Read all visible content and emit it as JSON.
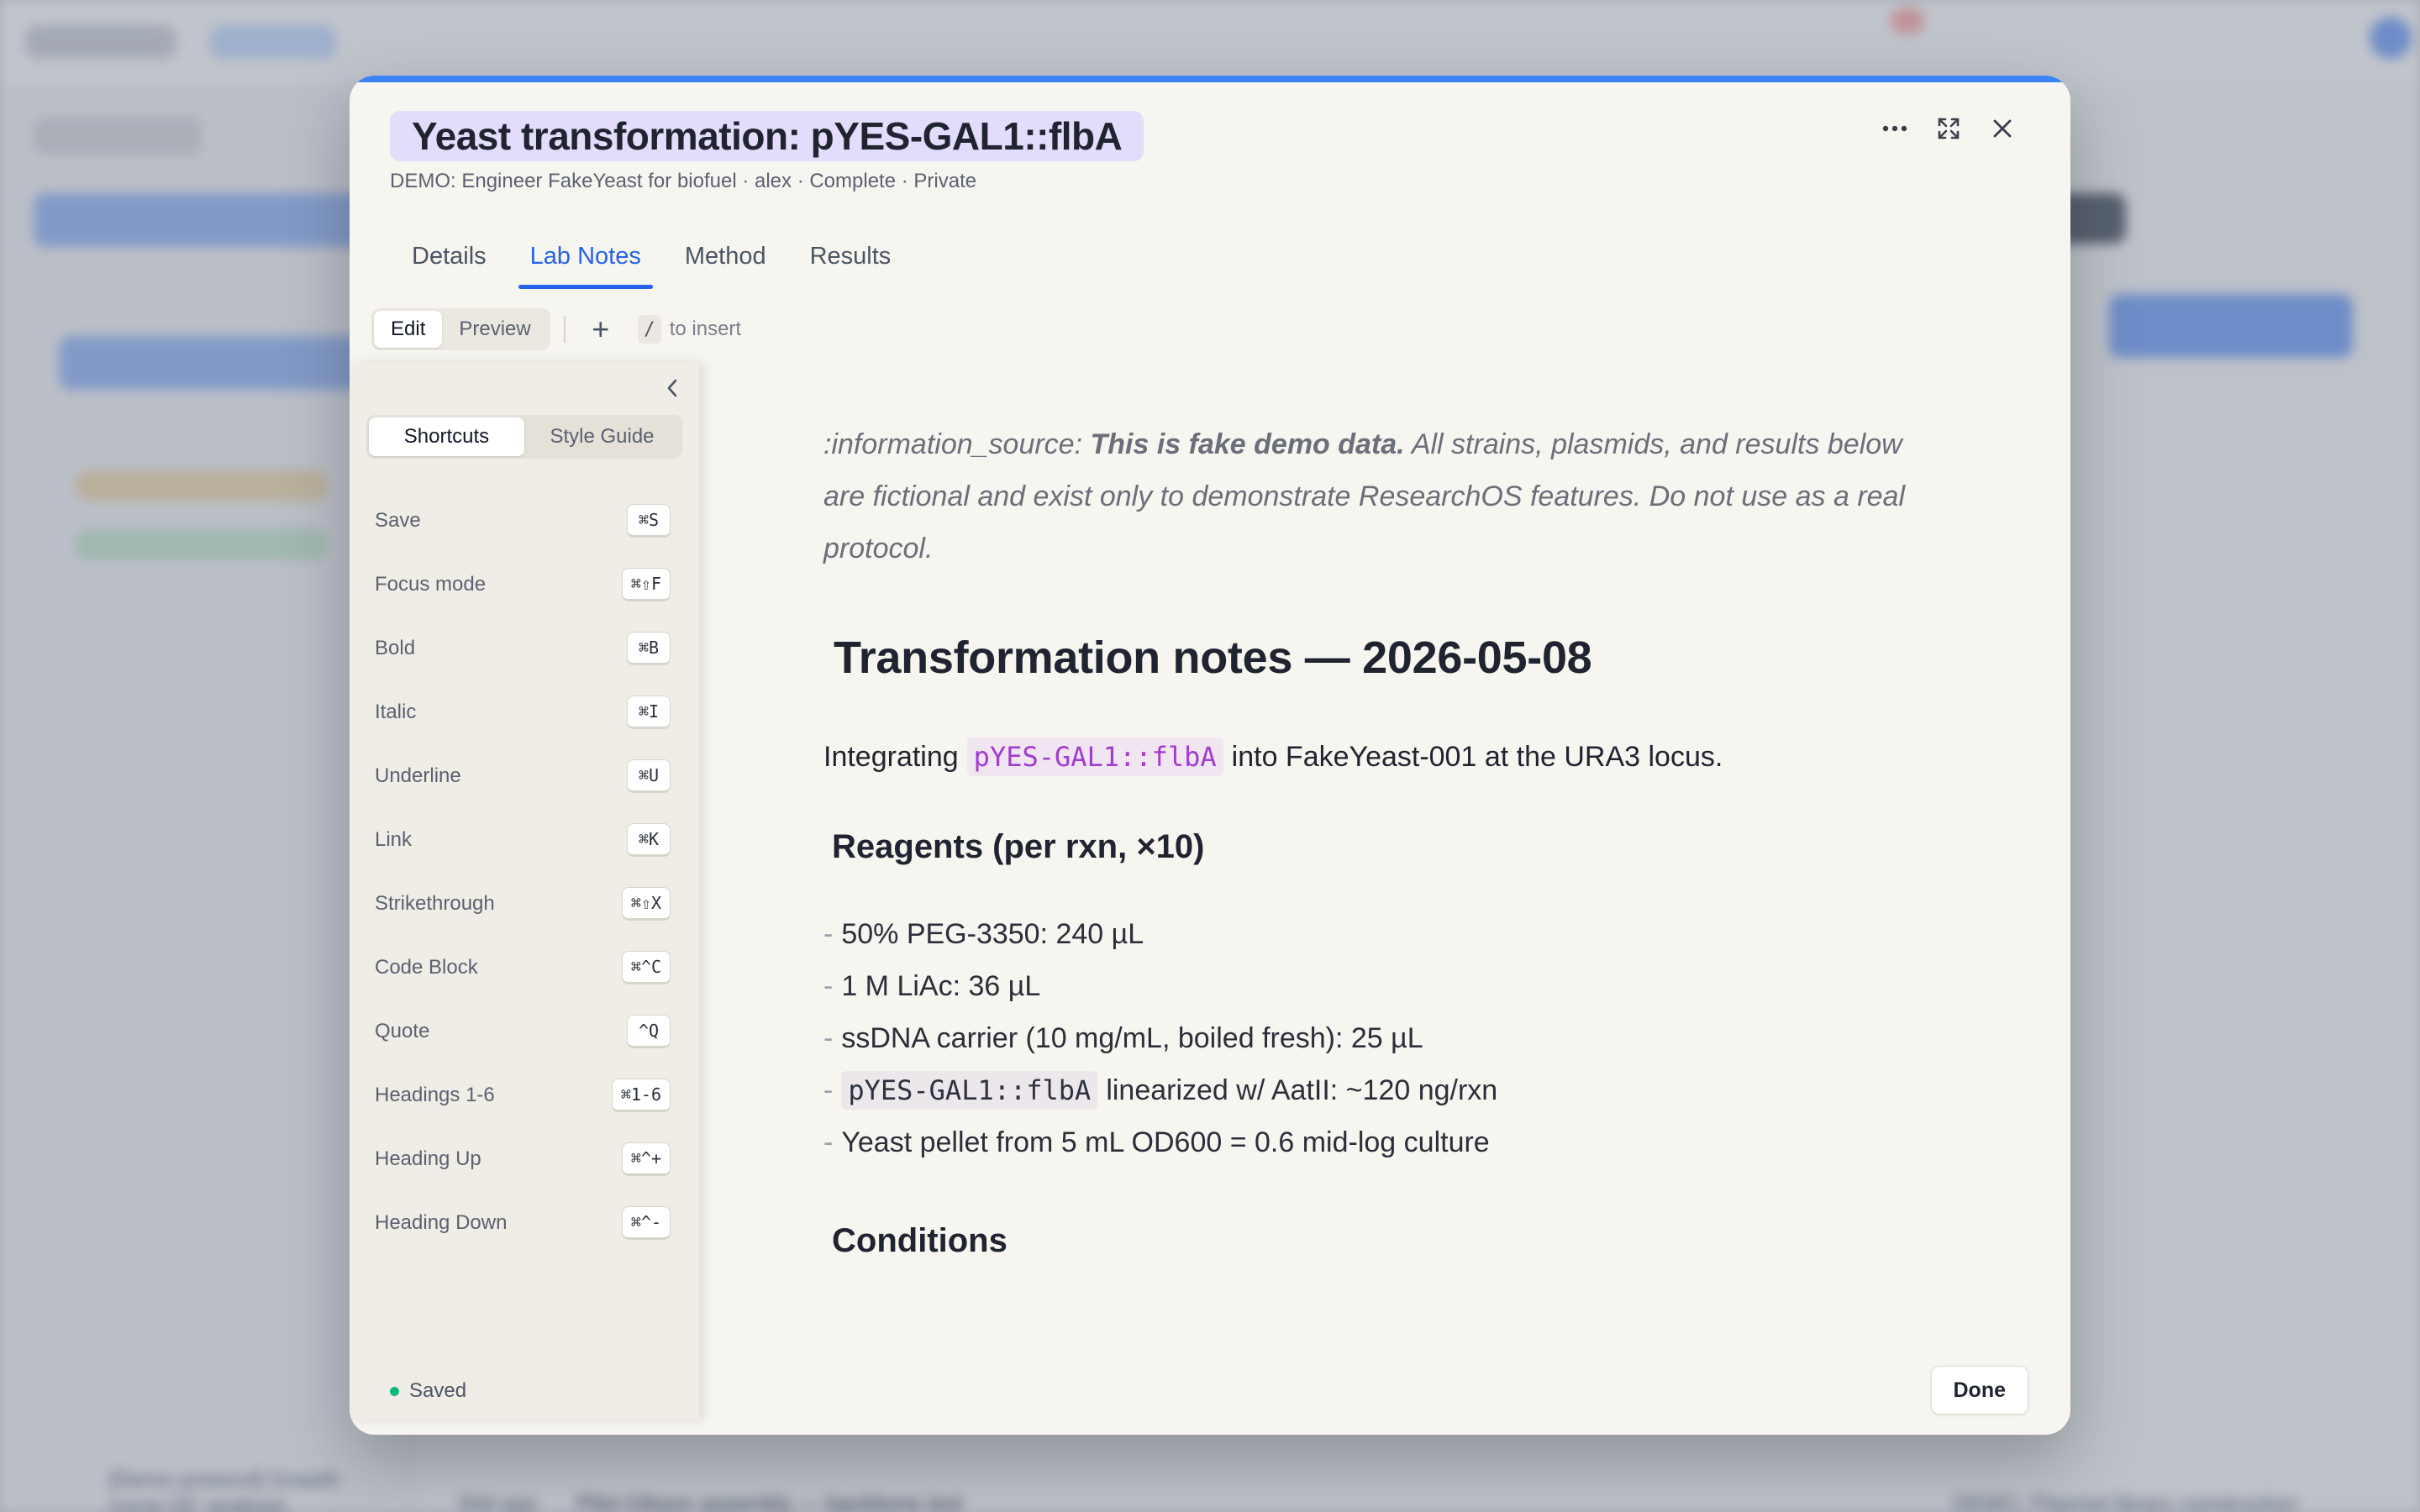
{
  "modal": {
    "title": "Yeast transformation: pYES-GAL1::flbA",
    "subtitle": "DEMO: Engineer FakeYeast for biofuel · alex · Complete · Private",
    "header_icons": [
      "more-horizontal-icon",
      "expand-icon",
      "close-icon"
    ],
    "accent_color": "#3b82f6"
  },
  "tabs": [
    {
      "label": "Details",
      "active": false
    },
    {
      "label": "Lab Notes",
      "active": true
    },
    {
      "label": "Method",
      "active": false
    },
    {
      "label": "Results",
      "active": false
    }
  ],
  "toolbar": {
    "edit_label": "Edit",
    "preview_label": "Preview",
    "plus_symbol": "+",
    "slash_key": "/",
    "insert_hint": "to insert"
  },
  "panel": {
    "shortcuts_tab": "Shortcuts",
    "style_guide_tab": "Style Guide",
    "shortcuts": [
      {
        "label": "Save",
        "keys": "⌘S"
      },
      {
        "label": "Focus mode",
        "keys": "⌘⇧F"
      },
      {
        "label": "Bold",
        "keys": "⌘B"
      },
      {
        "label": "Italic",
        "keys": "⌘I"
      },
      {
        "label": "Underline",
        "keys": "⌘U"
      },
      {
        "label": "Link",
        "keys": "⌘K"
      },
      {
        "label": "Strikethrough",
        "keys": "⌘⇧X"
      },
      {
        "label": "Code Block",
        "keys": "⌘^C"
      },
      {
        "label": "Quote",
        "keys": "^Q"
      },
      {
        "label": "Headings 1-6",
        "keys": "⌘1-6"
      },
      {
        "label": "Heading Up",
        "keys": "⌘^+"
      },
      {
        "label": "Heading Down",
        "keys": "⌘^-"
      }
    ]
  },
  "editor": {
    "note_prefix": ":information_source:",
    "note_bold": "This is fake demo data.",
    "note_rest": "All strains, plasmids, and results below are fictional and exist only to demonstrate ResearchOS features. Do not use as a real protocol.",
    "heading1": "Transformation notes — 2026-05-08",
    "intro_before": "Integrating",
    "intro_code": "pYES-GAL1::flbA",
    "intro_after": "into FakeYeast-001 at the URA3 locus.",
    "heading_reagents": "Reagents (per rxn, ×10)",
    "reagents": {
      "item1": "50% PEG-3350: 240 µL",
      "item2": "1 M LiAc: 36 µL",
      "item3": "ssDNA carrier (10 mg/mL, boiled fresh): 25 µL",
      "item4_code": "pYES-GAL1::flbA",
      "item4_rest": "linearized w/ AatII: ~120 ng/rxn",
      "item5": "Yeast pellet from 5 mL OD600 = 0.6 mid-log culture"
    },
    "dash": "-",
    "heading_conditions": "Conditions"
  },
  "footer": {
    "status": "Saved",
    "status_color": "#10b981",
    "done_label": "Done"
  },
  "background": {
    "bottom_time": "84d ago",
    "bottom_title": "Pilot Gibson assembly — backbone test",
    "bottom_project": "DEMO: Plasmid library construction",
    "bottom_left_line1": "[Demo protocol] Growth",
    "bottom_left_line2": "curve QC analysis"
  }
}
